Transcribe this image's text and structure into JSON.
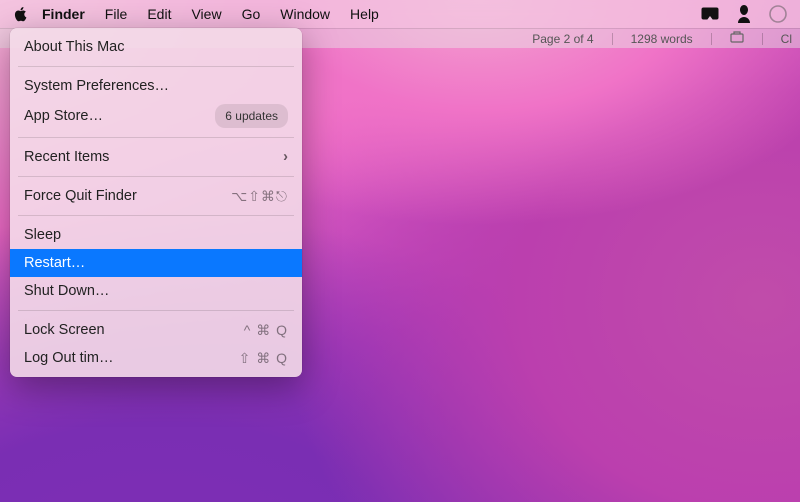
{
  "menubar": {
    "items": [
      "Finder",
      "File",
      "Edit",
      "View",
      "Go",
      "Window",
      "Help"
    ]
  },
  "statusbar": {
    "page": "Page 2 of 4",
    "words": "1298 words",
    "extra": "Cl"
  },
  "apple_menu": {
    "about": "About This Mac",
    "preferences": "System Preferences…",
    "appstore": "App Store…",
    "appstore_badge": "6 updates",
    "recent": "Recent Items",
    "forcequit": "Force Quit Finder",
    "forcequit_keys": "⌥⇧⌘⎋",
    "sleep": "Sleep",
    "restart": "Restart…",
    "shutdown": "Shut Down…",
    "lock": "Lock Screen",
    "lock_keys": "^ ⌘ Q",
    "logout": "Log Out tim…",
    "logout_keys": "⇧ ⌘ Q"
  }
}
